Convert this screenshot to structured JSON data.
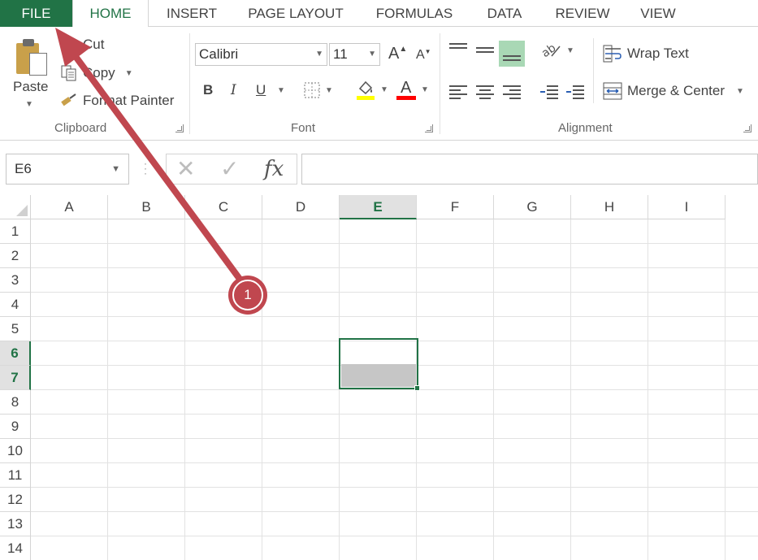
{
  "tabs": {
    "file": "FILE",
    "home": "HOME",
    "insert": "INSERT",
    "page_layout": "PAGE LAYOUT",
    "formulas": "FORMULAS",
    "data": "DATA",
    "review": "REVIEW",
    "view": "VIEW"
  },
  "clipboard": {
    "label": "Clipboard",
    "paste": "Paste",
    "cut": "Cut",
    "copy": "Copy",
    "format_painter": "Format Painter"
  },
  "font": {
    "label": "Font",
    "name": "Calibri",
    "size": "11",
    "grow": "A",
    "shrink": "A",
    "bold": "B",
    "italic": "I",
    "underline": "U",
    "font_color_letter": "A",
    "fill_color": "#ffff00",
    "font_color": "#ff0000"
  },
  "alignment": {
    "label": "Alignment",
    "wrap_text": "Wrap Text",
    "merge_center": "Merge & Center"
  },
  "formula_bar": {
    "name_box": "E6",
    "cancel": "✕",
    "enter": "✓",
    "fx": "fx",
    "value": ""
  },
  "grid": {
    "columns": [
      "A",
      "B",
      "C",
      "D",
      "E",
      "F",
      "G",
      "H",
      "I"
    ],
    "rows": [
      "1",
      "2",
      "3",
      "4",
      "5",
      "6",
      "7",
      "8",
      "9",
      "10",
      "11",
      "12",
      "13",
      "14"
    ],
    "selected_column": "E",
    "selected_rows": [
      "6",
      "7"
    ],
    "accent": "#217346"
  },
  "annotation": {
    "step": "1",
    "color": "#c0474f"
  }
}
